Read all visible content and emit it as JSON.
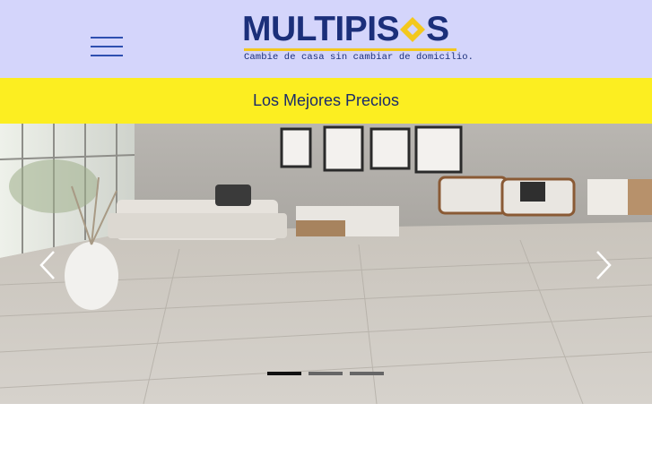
{
  "brand": {
    "name_part1": "MULTIPIS",
    "name_part2": "S",
    "tagline": "Cambie de casa sin cambiar de domicilio.",
    "colors": {
      "navy": "#1b2f7a",
      "yellow": "#f3c81d",
      "header_bg": "#d4d5fb"
    }
  },
  "menu": {
    "icon": "hamburger-menu-icon"
  },
  "promo_banner": {
    "text": "Los Mejores Precios",
    "background": "#fcee21"
  },
  "carousel": {
    "slide_description_icon": "living-room-floor-photo",
    "prev_icon": "chevron-left-icon",
    "next_icon": "chevron-right-icon",
    "slide_count": 3,
    "active_index": 0
  }
}
